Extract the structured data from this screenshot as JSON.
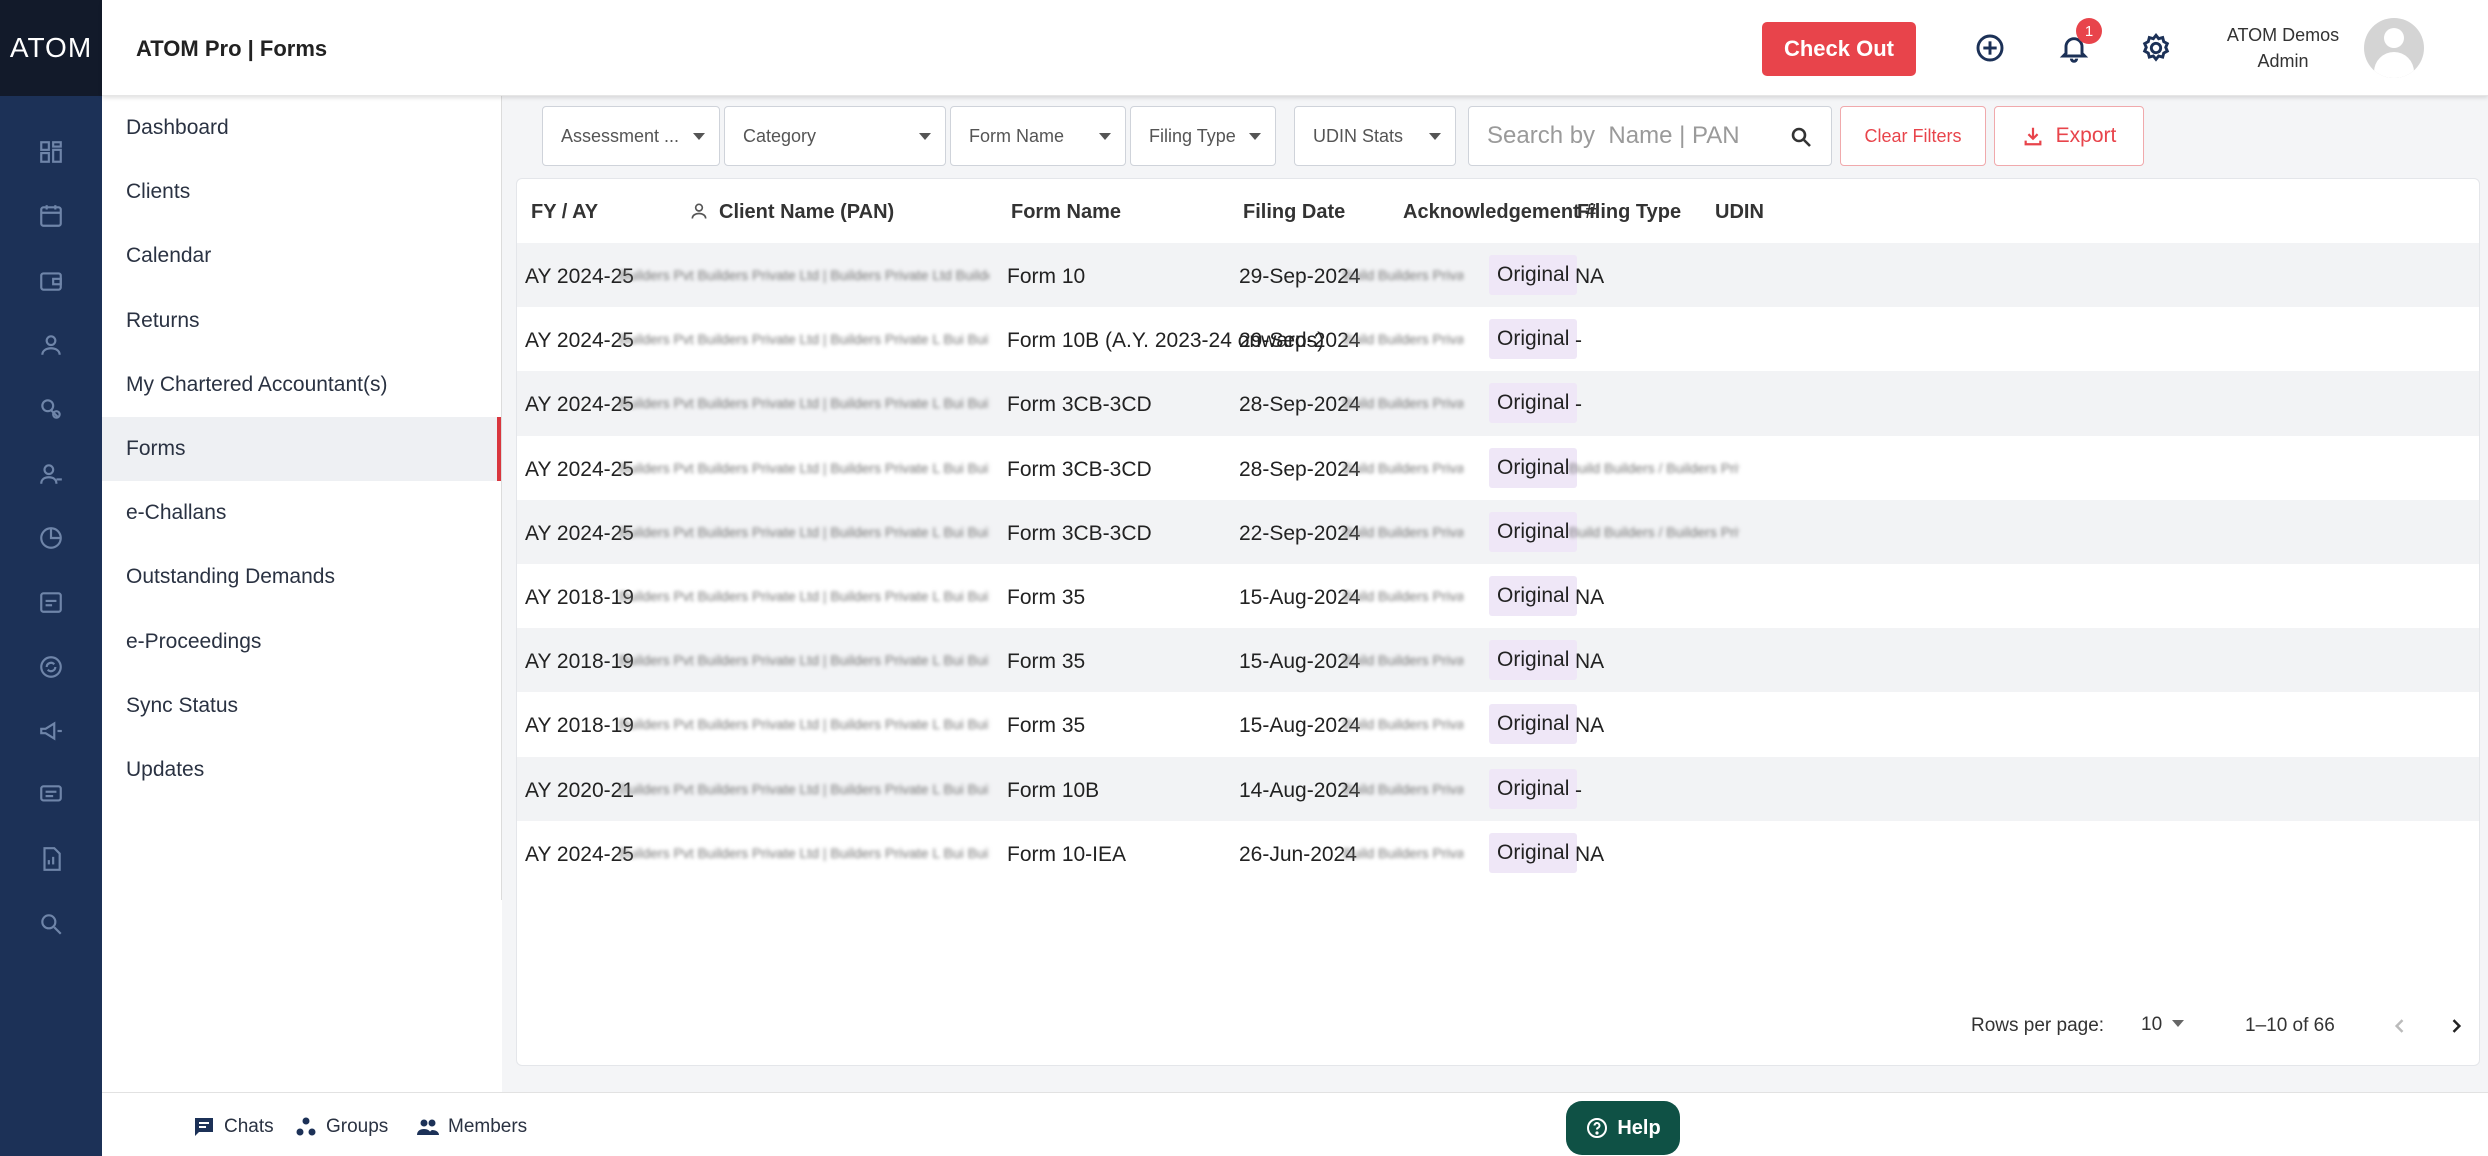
{
  "rail": {
    "logo": "ATOM"
  },
  "header": {
    "title": "ATOM Pro | Forms",
    "checkout_label": "Check Out",
    "notification_count": "1",
    "user_name": "ATOM Demos",
    "user_role": "Admin"
  },
  "sidebar": {
    "items": [
      {
        "label": "Dashboard"
      },
      {
        "label": "Clients"
      },
      {
        "label": "Calendar"
      },
      {
        "label": "Returns"
      },
      {
        "label": "My Chartered Accountant(s)"
      },
      {
        "label": "Forms"
      },
      {
        "label": "e-Challans"
      },
      {
        "label": "Outstanding Demands"
      },
      {
        "label": "e-Proceedings"
      },
      {
        "label": "Sync Status"
      },
      {
        "label": "Updates"
      }
    ],
    "active": "Forms"
  },
  "filters": {
    "assessment": "Assessment ...",
    "category": "Category",
    "form_name": "Form Name",
    "filing_type": "Filing Type",
    "udin_stats": "UDIN Stats",
    "search_placeholder": "Search by  Name | PAN",
    "clear_label": "Clear Filters",
    "export_label": "Export"
  },
  "table": {
    "headers": {
      "fy": "FY / AY",
      "client": "Client Name (PAN)",
      "form": "Form Name",
      "date": "Filing Date",
      "ack": "Acknowledgement #",
      "type": "Filing Type",
      "udin": "UDIN"
    },
    "rows": [
      {
        "fy": "AY 2024-25",
        "client": "Builders Pvt Builders Private Ltd | Builders Private Ltd Builders Private Ltd",
        "form": "Form 10",
        "date": "29-Sep-2024",
        "ack": "Build Builders Private Ltd",
        "type": "Original",
        "udin": "NA"
      },
      {
        "fy": "AY 2024-25",
        "client": "Builders Pvt Builders Private Ltd | Builders Private L Bui Builders Private Ltd",
        "form": "Form 10B (A.Y. 2023-24 onwards)",
        "date": "29-Sep-2024",
        "ack": "Build Builders Private Ltd",
        "type": "Original",
        "udin": "-"
      },
      {
        "fy": "AY 2024-25",
        "client": "Builders Pvt Builders Private Ltd | Builders Private L Bui Builders Private Ltd",
        "form": "Form 3CB-3CD",
        "date": "28-Sep-2024",
        "ack": "Build Builders Private Ltd",
        "type": "Original",
        "udin": "-"
      },
      {
        "fy": "AY 2024-25",
        "client": "Builders Pvt Builders Private Ltd | Builders Private L Bui Builders Private Ltd",
        "form": "Form 3CB-3CD",
        "date": "28-Sep-2024",
        "ack": "Build Builders Private Ltd",
        "type": "Original",
        "udin": "Build Builders / Builders Private Ltd"
      },
      {
        "fy": "AY 2024-25",
        "client": "Builders Pvt Builders Private Ltd | Builders Private L Bui Builders Private Ltd",
        "form": "Form 3CB-3CD",
        "date": "22-Sep-2024",
        "ack": "Build Builders Private Ltd",
        "type": "Original",
        "udin": "Build Builders / Builders Private Ltd"
      },
      {
        "fy": "AY 2018-19",
        "client": "Builders Pvt Builders Private Ltd | Builders Private L Bui Builders Private Ltd",
        "form": "Form 35",
        "date": "15-Aug-2024",
        "ack": "Build Builders Private Ltd",
        "type": "Original",
        "udin": "NA"
      },
      {
        "fy": "AY 2018-19",
        "client": "Builders Pvt Builders Private Ltd | Builders Private L Bui Builders Private Ltd",
        "form": "Form 35",
        "date": "15-Aug-2024",
        "ack": "Build Builders Private Ltd",
        "type": "Original",
        "udin": "NA"
      },
      {
        "fy": "AY 2018-19",
        "client": "Builders Pvt Builders Private Ltd | Builders Private L Bui Builders Private Ltd",
        "form": "Form 35",
        "date": "15-Aug-2024",
        "ack": "Build Builders Private Ltd",
        "type": "Original",
        "udin": "NA"
      },
      {
        "fy": "AY 2020-21",
        "client": "Builders Pvt Builders Private Ltd | Builders Private L Bui Builders Private Ltd",
        "form": "Form 10B",
        "date": "14-Aug-2024",
        "ack": "Build Builders Private Ltd",
        "type": "Original",
        "udin": "-"
      },
      {
        "fy": "AY 2024-25",
        "client": "Builders Pvt Builders Private Ltd | Builders Private L Bui Builders Private Ltd",
        "form": "Form 10-IEA",
        "date": "26-Jun-2024",
        "ack": "Build Builders Private Ltd",
        "type": "Original",
        "udin": "NA"
      }
    ]
  },
  "pagination": {
    "rows_label": "Rows per page:",
    "rows_value": "10",
    "range": "1–10 of 66"
  },
  "bottombar": {
    "chats": "Chats",
    "groups": "Groups",
    "members": "Members",
    "help": "Help"
  }
}
